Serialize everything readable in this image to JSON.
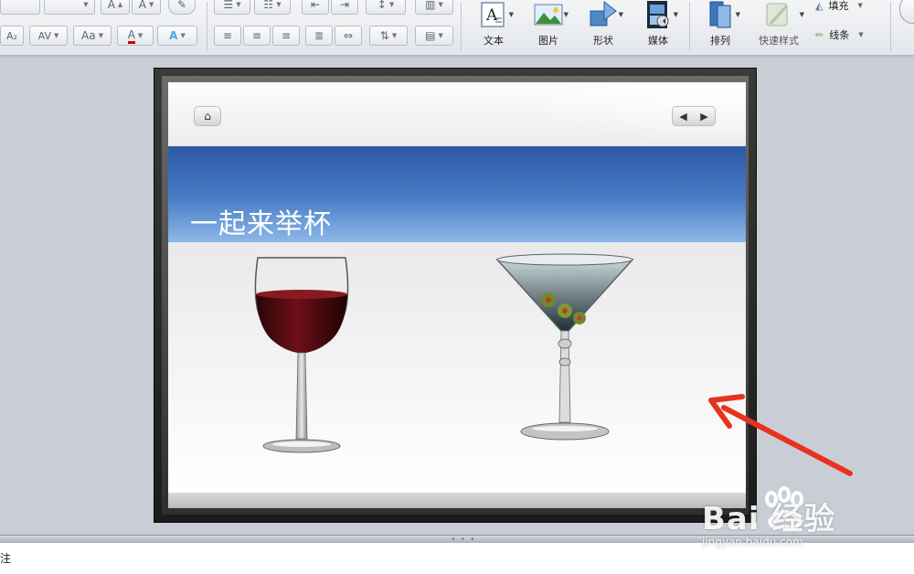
{
  "ribbon": {
    "text_box_label": "文本",
    "picture_label": "图片",
    "shape_label": "形状",
    "media_label": "媒体",
    "arrange_label": "排列",
    "quick_styles_label": "快速样式",
    "fill_label": "填充",
    "line_label": "线条",
    "font_grow_glyph": "A",
    "font_shrink_glyph": "A",
    "subscript_glyph": "A₂",
    "char_spacing_glyph": "AV",
    "change_case_glyph": "Aa",
    "font_color_glyph": "A",
    "text_effects_glyph": "A"
  },
  "slide": {
    "title": "一起来举杯",
    "home_glyph": "⌂",
    "prev_glyph": "◀",
    "next_glyph": "▶",
    "images": [
      {
        "name": "red-wine-glass"
      },
      {
        "name": "martini-glass-with-olives"
      }
    ]
  },
  "notes": {
    "label": "注"
  },
  "divider": {
    "grip": "• • •"
  },
  "watermark": {
    "brand": "Bai 经验",
    "url": "jingyan.baidu.com"
  },
  "colors": {
    "accent_blue": "#2c58a6",
    "arrow_red": "#e8321e"
  }
}
